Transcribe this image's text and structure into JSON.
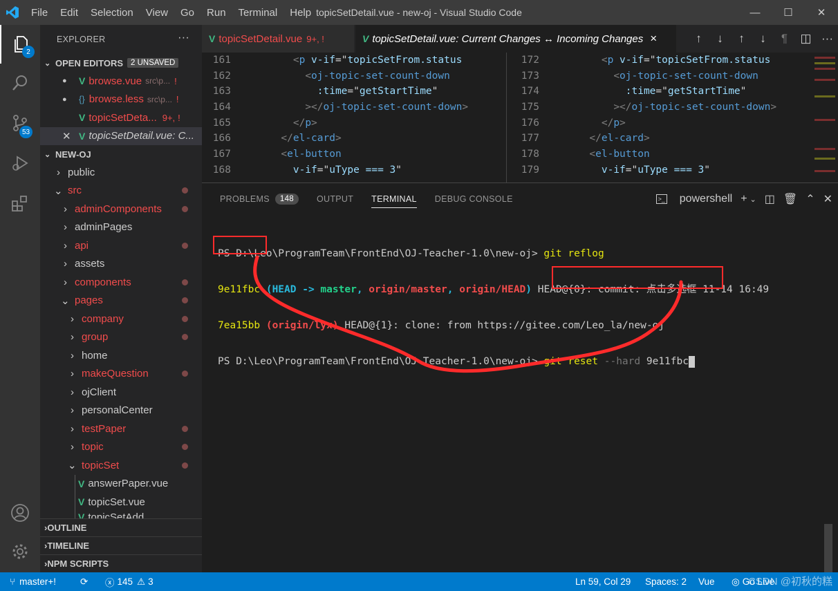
{
  "window": {
    "title": "topicSetDetail.vue - new-oj - Visual Studio Code",
    "menu": [
      "File",
      "Edit",
      "Selection",
      "View",
      "Go",
      "Run",
      "Terminal",
      "Help"
    ]
  },
  "activity": {
    "explorer_badge": "2",
    "scm_badge": "53"
  },
  "explorer": {
    "header": "EXPLORER",
    "open_editors_label": "OPEN EDITORS",
    "unsaved_badge": "2 UNSAVED",
    "open_editors": [
      {
        "icon": "V",
        "name": "browse.vue",
        "path": "src\\p...",
        "mark": "!"
      },
      {
        "icon": "{}",
        "name": "browse.less",
        "path": "src\\p...",
        "mark": "!"
      },
      {
        "icon": "V",
        "name": "topicSetDeta...",
        "path": "9+,",
        "mark": "!"
      },
      {
        "icon": "V",
        "name": "topicSetDetail.vue: C..."
      }
    ],
    "project_label": "NEW-OJ",
    "tree": [
      {
        "name": "public"
      },
      {
        "name": "src"
      },
      {
        "name": "adminComponents"
      },
      {
        "name": "adminPages"
      },
      {
        "name": "api"
      },
      {
        "name": "assets"
      },
      {
        "name": "components"
      },
      {
        "name": "pages"
      },
      {
        "name": "company"
      },
      {
        "name": "group"
      },
      {
        "name": "home"
      },
      {
        "name": "makeQuestion"
      },
      {
        "name": "ojClient"
      },
      {
        "name": "personalCenter"
      },
      {
        "name": "testPaper"
      },
      {
        "name": "topic"
      },
      {
        "name": "topicSet"
      },
      {
        "name": "answerPaper.vue"
      },
      {
        "name": "topicSet.vue"
      },
      {
        "name": "topicSetAdd..."
      }
    ],
    "outline": "OUTLINE",
    "timeline": "TIMELINE",
    "npm": "NPM SCRIPTS"
  },
  "tabs": {
    "tab1": {
      "name": "topicSetDetail.vue",
      "status": "9+, !"
    },
    "tab2": {
      "name": "topicSetDetail.vue: Current Changes ↔ Incoming Changes"
    },
    "close": "×"
  },
  "editor_left": {
    "lines": [
      "161",
      "162",
      "163",
      "164",
      "165",
      "166",
      "167",
      "168"
    ]
  },
  "editor_right": {
    "lines": [
      "172",
      "173",
      "174",
      "175",
      "176",
      "177",
      "178",
      "179"
    ]
  },
  "code": {
    "l1_tag": "p",
    "l1_attr": "v-if",
    "l1_val": "topicSetFrom.status",
    "l2_tag": "oj-topic-set-count-down",
    "l3_attr": ":time",
    "l3_val": "getStartTime",
    "l4_tag": "oj-topic-set-count-down",
    "l5_tag": "p",
    "l6_tag": "el-card",
    "l7_tag": "el-button",
    "l8_attr": "v-if",
    "l8_val": "uType === 3"
  },
  "panel": {
    "tabs": [
      "PROBLEMS",
      "OUTPUT",
      "TERMINAL",
      "DEBUG CONSOLE"
    ],
    "problems_count": "148",
    "shell": "powershell"
  },
  "terminal": {
    "prompt": "PS D:\\Leo\\ProgramTeam\\FrontEnd\\OJ-Teacher-1.0\\new-oj>",
    "cmd1": "git reflog",
    "hash1": "9e11fbc",
    "head": "HEAD ->",
    "branch_master": "master",
    "comma": ",",
    "origin_master": "origin/master",
    "origin_head": "origin/HEAD",
    "line2_rest": "HEAD@{0}: commit: 点击多选框 11-14 16:49",
    "hash2": "7ea15bb",
    "origin_lyx": "(origin/lyx)",
    "line3_rest": "HEAD@{1}: clone: from https://gitee.com/Leo_la/new-oj",
    "cmd2_git": "git reset",
    "cmd2_flag": "--hard",
    "cmd2_arg": "9e11fbc"
  },
  "status": {
    "branch": "master+!",
    "errors": "145",
    "warnings": "3",
    "position": "Ln 59, Col 29",
    "spaces": "Spaces: 2",
    "lang": "Vue",
    "golive": "Go Live",
    "watermark": "CSDN @初秋的糕"
  },
  "colors": {
    "accent": "#007acc",
    "annotation": "#ff2b2b"
  }
}
